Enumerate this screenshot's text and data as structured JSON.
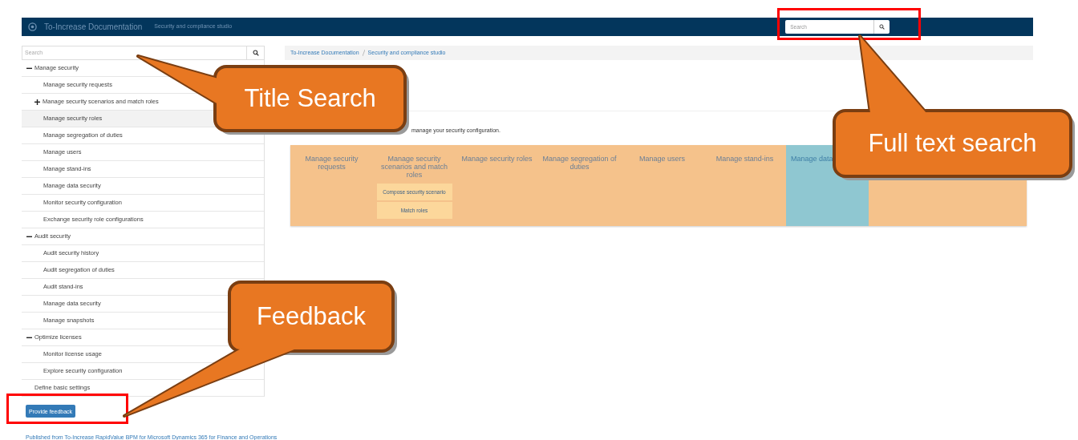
{
  "header": {
    "title": "To-Increase Documentation",
    "subtitle": "Security and compliance studio",
    "search": {
      "placeholder": "Search"
    }
  },
  "sidebar": {
    "search": {
      "placeholder": "Search"
    },
    "tree": [
      {
        "label": "Manage security",
        "expanded": true,
        "selected": false,
        "children": [
          {
            "label": "Manage security requests",
            "selected": false
          },
          {
            "label": "Manage security scenarios and match roles",
            "expanded": false,
            "selected": false
          },
          {
            "label": "Manage security roles",
            "selected": true
          },
          {
            "label": "Manage segregation of duties",
            "selected": false
          },
          {
            "label": "Manage users",
            "selected": false
          },
          {
            "label": "Manage stand-ins",
            "selected": false
          },
          {
            "label": "Manage data security",
            "selected": false
          },
          {
            "label": "Monitor security configuration",
            "selected": false
          },
          {
            "label": "Exchange security role configurations",
            "selected": false
          }
        ]
      },
      {
        "label": "Audit security",
        "expanded": true,
        "selected": false,
        "children": [
          {
            "label": "Audit security history",
            "selected": false
          },
          {
            "label": "Audit segregation of duties",
            "selected": false
          },
          {
            "label": "Audit stand-ins",
            "selected": false
          },
          {
            "label": "Manage data security",
            "selected": false
          },
          {
            "label": "Manage snapshots",
            "selected": false
          }
        ]
      },
      {
        "label": "Optimize licenses",
        "expanded": true,
        "selected": false,
        "children": [
          {
            "label": "Monitor license usage",
            "selected": false
          },
          {
            "label": "Explore security configuration",
            "selected": false
          }
        ]
      },
      {
        "label": "Define basic settings",
        "selected": false
      }
    ]
  },
  "feedback_button": "Provide feedback",
  "footer": "Published from To-Increase RapidValue BPM for Microsoft Dynamics 365 for Finance and Operations",
  "breadcrumb": [
    "To-Increase Documentation",
    "Security and compliance studio"
  ],
  "intro": "manage your security configuration.",
  "process_map": [
    {
      "title": "Manage security requests",
      "color": "#f5c28b"
    },
    {
      "title": "Manage security scenarios and match roles",
      "color": "#f5c28b",
      "items": [
        "Compose security scenario",
        "Match roles"
      ]
    },
    {
      "title": "Manage security roles",
      "color": "#f5c28b"
    },
    {
      "title": "Manage segregation of duties",
      "color": "#f5c28b"
    },
    {
      "title": "Manage users",
      "color": "#f5c28b"
    },
    {
      "title": "Manage stand-ins",
      "color": "#f5c28b"
    },
    {
      "title": "Manage data",
      "color": "#8fc7d1",
      "covered": true
    }
  ],
  "callouts": [
    {
      "text": "Title Search"
    },
    {
      "text": "Full text search"
    },
    {
      "text": "Feedback"
    }
  ]
}
